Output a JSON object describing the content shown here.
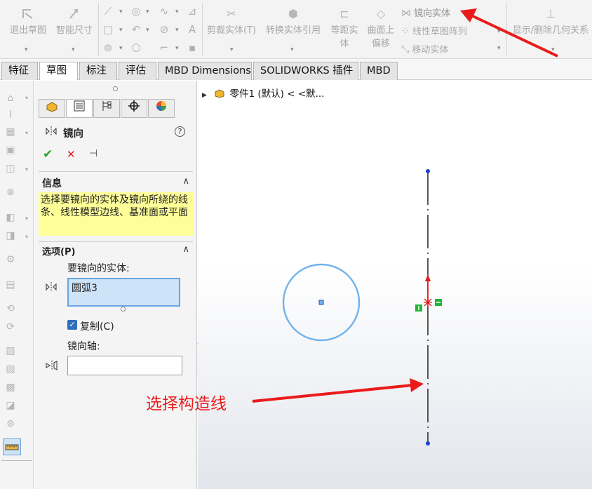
{
  "ribbon": {
    "exit_sketch": "退出草图",
    "smart_dimension": "智能尺寸",
    "trim_entities": "剪裁实体(T)",
    "convert_entities": "转换实体引用",
    "offset_line1": "等距实",
    "offset_line2": "体",
    "surface_offset_line1": "曲面上",
    "surface_offset_line2": "偏移",
    "mirror_entities": "镜向实体",
    "linear_pattern": "线性草图阵列",
    "move_entities": "移动实体",
    "display_delete_relations": "显示/删除几何关系"
  },
  "tabs": [
    {
      "label": "特征",
      "active": false
    },
    {
      "label": "草图",
      "active": true
    },
    {
      "label": "标注",
      "active": false
    },
    {
      "label": "评估",
      "active": false
    },
    {
      "label": "MBD Dimensions",
      "active": false
    },
    {
      "label": "SOLIDWORKS 插件",
      "active": false
    },
    {
      "label": "MBD",
      "active": false
    }
  ],
  "panel": {
    "title": "镜向",
    "help": "?",
    "ok_glyph": "✔",
    "cancel_glyph": "✕",
    "pin_glyph": "⊣",
    "info_title": "信息",
    "info_text": "选择要镜向的实体及镜向所绕的线条、线性模型边线、基准面或平面",
    "options_title": "选项(P)",
    "entities_label": "要镜向的实体:",
    "entity_item": "圆弧3",
    "copy_label": "复制(C)",
    "copy_checked": true,
    "axis_label": "镜向轴:",
    "axis_value": ""
  },
  "tree": {
    "root_label": "零件1 (默认) < <默..."
  },
  "annotation": {
    "text": "选择构造线",
    "color": "#ea1b1b"
  },
  "colors": {
    "circle": "#6fb3ec",
    "construction_line": "#111111",
    "endpoint": "#1f3fd1",
    "accent_select": "#67a6e0",
    "info_bg": "#ffff99",
    "relation_green": "#1fb83a"
  }
}
